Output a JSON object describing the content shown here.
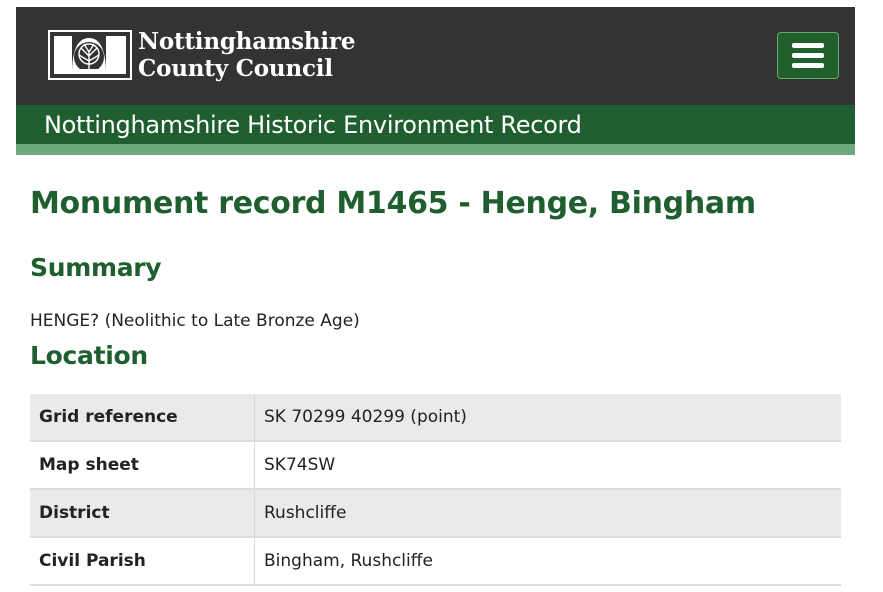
{
  "header": {
    "org_line1": "Nottinghamshire",
    "org_line2": "County Council",
    "logo_icon": "county-council-crest-icon",
    "menu_icon": "hamburger-menu-icon",
    "colors": {
      "topbar": "#333333",
      "brand_green": "#1f5e2f",
      "light_green": "#6ea97a",
      "menu_button": "#215f2c"
    }
  },
  "banner": {
    "title": "Nottinghamshire Historic Environment Record"
  },
  "record": {
    "title": "Monument record M1465 - Henge, Bingham"
  },
  "summary": {
    "heading": "Summary",
    "text": "HENGE? (Neolithic to Late Bronze Age)"
  },
  "location": {
    "heading": "Location",
    "rows": [
      {
        "key": "Grid reference",
        "value": "SK 70299 40299 (point)"
      },
      {
        "key": "Map sheet",
        "value": "SK74SW"
      },
      {
        "key": "District",
        "value": "Rushcliffe"
      },
      {
        "key": "Civil Parish",
        "value": "Bingham, Rushcliffe"
      }
    ]
  }
}
